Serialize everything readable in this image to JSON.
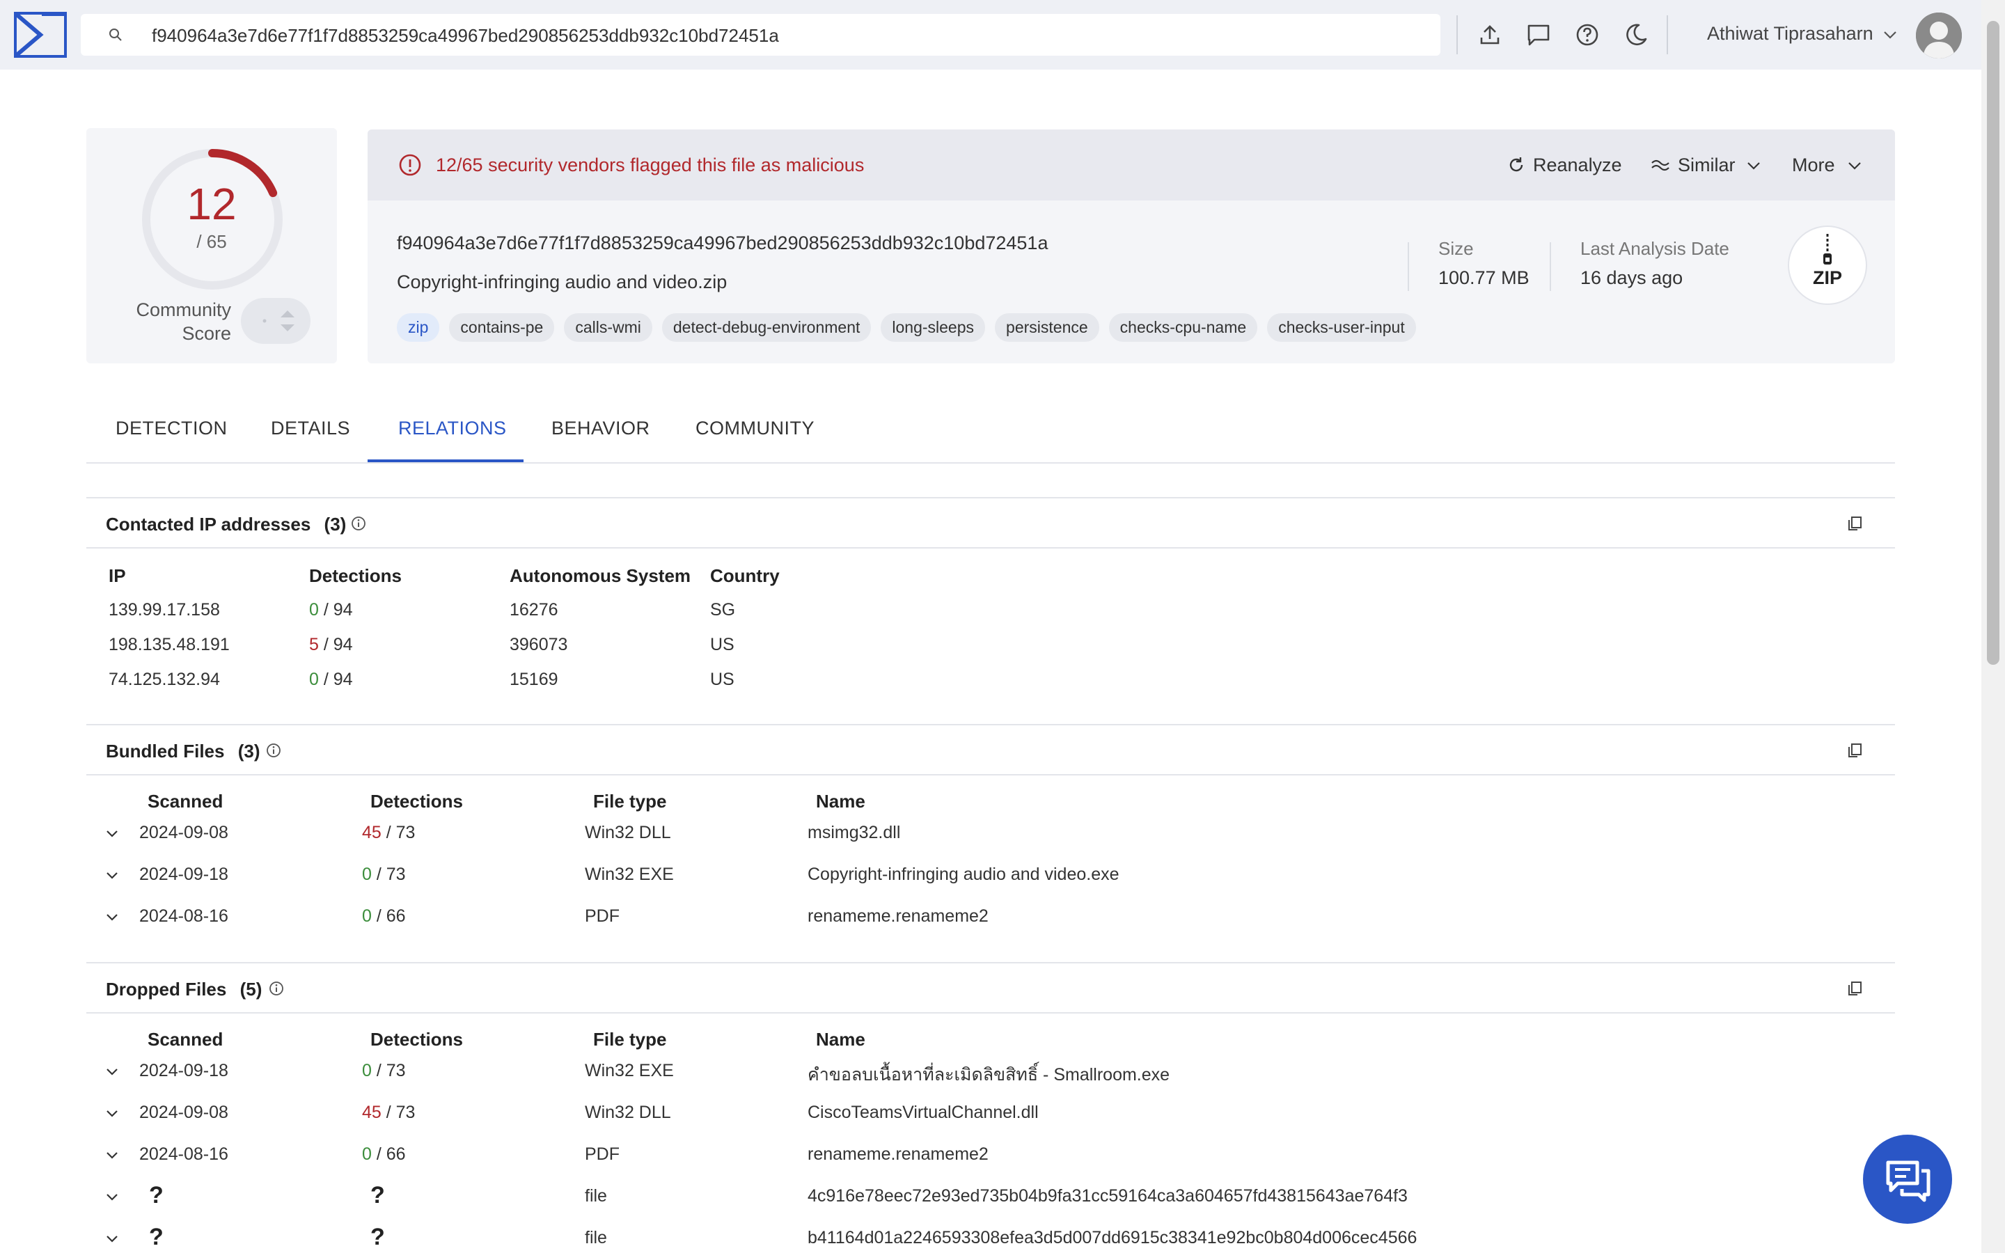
{
  "search": {
    "value": "f940964a3e7d6e77f1f7d8853259ca49967bed290856253ddb932c10bd72451a"
  },
  "header": {
    "user_name": "Athiwat Tiprasaharn"
  },
  "score": {
    "detections": "12",
    "total": "/ 65",
    "community_label": "Community Score"
  },
  "alert": {
    "text": "12/65 security vendors flagged this file as malicious"
  },
  "actions": {
    "reanalyze": "Reanalyze",
    "similar": "Similar",
    "more": "More"
  },
  "file": {
    "hash": "f940964a3e7d6e77f1f7d8853259ca49967bed290856253ddb932c10bd72451a",
    "name": "Copyright-infringing audio and video.zip",
    "tags": [
      "zip",
      "contains-pe",
      "calls-wmi",
      "detect-debug-environment",
      "long-sleeps",
      "persistence",
      "checks-cpu-name",
      "checks-user-input"
    ],
    "size_label": "Size",
    "size_value": "100.77 MB",
    "date_label": "Last Analysis Date",
    "date_value": "16 days ago",
    "type_badge": "ZIP"
  },
  "tabs": [
    "DETECTION",
    "DETAILS",
    "RELATIONS",
    "BEHAVIOR",
    "COMMUNITY"
  ],
  "contacted_ips": {
    "title": "Contacted IP addresses",
    "count": "(3)",
    "headers": [
      "IP",
      "Detections",
      "Autonomous System",
      "Country"
    ],
    "rows": [
      {
        "ip": "139.99.17.158",
        "det": "0",
        "total": "/ 94",
        "as": "16276",
        "country": "SG"
      },
      {
        "ip": "198.135.48.191",
        "det": "5",
        "total": "/ 94",
        "as": "396073",
        "country": "US"
      },
      {
        "ip": "74.125.132.94",
        "det": "0",
        "total": "/ 94",
        "as": "15169",
        "country": "US"
      }
    ]
  },
  "bundled": {
    "title": "Bundled Files",
    "count": "(3)",
    "headers": [
      "Scanned",
      "Detections",
      "File type",
      "Name"
    ],
    "rows": [
      {
        "scanned": "2024-09-08",
        "det": "45",
        "total": "/ 73",
        "type": "Win32 DLL",
        "name": "msimg32.dll"
      },
      {
        "scanned": "2024-09-18",
        "det": "0",
        "total": "/ 73",
        "type": "Win32 EXE",
        "name": "Copyright-infringing audio and video.exe"
      },
      {
        "scanned": "2024-08-16",
        "det": "0",
        "total": "/ 66",
        "type": "PDF",
        "name": "renameme.renameme2"
      }
    ]
  },
  "dropped": {
    "title": "Dropped Files",
    "count": "(5)",
    "headers": [
      "Scanned",
      "Detections",
      "File type",
      "Name"
    ],
    "rows": [
      {
        "scanned": "2024-09-18",
        "det": "0",
        "total": "/ 73",
        "type": "Win32 EXE",
        "name": "คำขอลบเนื้อหาที่ละเมิดลิขสิทธิ์ - Smallroom.exe"
      },
      {
        "scanned": "2024-09-08",
        "det": "45",
        "total": "/ 73",
        "type": "Win32 DLL",
        "name": "CiscoTeamsVirtualChannel.dll"
      },
      {
        "scanned": "2024-08-16",
        "det": "0",
        "total": "/ 66",
        "type": "PDF",
        "name": "renameme.renameme2"
      },
      {
        "scanned": "?",
        "det": "?",
        "total": "",
        "type": "file",
        "name": "4c916e78eec72e93ed735b04b9fa31cc59164ca3a604657fd43815643ae764f3"
      },
      {
        "scanned": "?",
        "det": "?",
        "total": "",
        "type": "file",
        "name": "b41164d01a2246593308efea3d5d007dd6915c38341e92bc0b804d006cec4566"
      }
    ]
  },
  "colors": {
    "accent": "#2a56c6",
    "malicious": "#b1282c",
    "clean": "#3b8d3b"
  }
}
